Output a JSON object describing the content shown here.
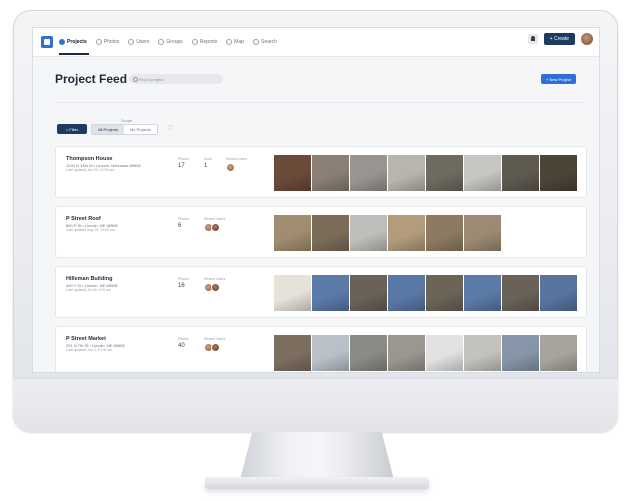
{
  "nav": {
    "items": [
      {
        "label": "Projects",
        "active": true
      },
      {
        "label": "Photos",
        "active": false
      },
      {
        "label": "Users",
        "active": false
      },
      {
        "label": "Groups",
        "active": false
      },
      {
        "label": "Reports",
        "active": false
      },
      {
        "label": "Map",
        "active": false
      },
      {
        "label": "Search",
        "active": false
      }
    ],
    "create_label": "+ Create"
  },
  "header": {
    "title": "Project Feed",
    "search_placeholder": "Find a project",
    "new_project_label": "+ New Project"
  },
  "filters": {
    "scope_label": "Scope",
    "filter_label": "= Filter",
    "all_projects_label": "All Projects",
    "my_projects_label": "My Projects"
  },
  "projects": [
    {
      "name": "Thompson House",
      "address": "1234 N 14th St • Lincoln, Nebraska 68508",
      "updated": "Last updated Jun 23, 10:00 am",
      "photos_label": "Photos",
      "photos": "17",
      "docs_label": "Docs",
      "docs": "1",
      "users_label": "Recent Users",
      "thumbs": [
        "#6b4a3a",
        "#8a7f74",
        "#9a9490",
        "#b8b4ae",
        "#6e6a60",
        "#c8c6c2",
        "#5f5a50",
        "#4d4438"
      ]
    },
    {
      "name": "P Street Roof",
      "address": "800 P St • Lincoln, NE 68508",
      "updated": "Last updated Aug 20, 10:00 am",
      "photos_label": "Photos",
      "photos": "6",
      "users_label": "Recent Users",
      "thumbs": [
        "#a08d70",
        "#7c6c5a",
        "#c0beba",
        "#b29c7c",
        "#8d7a62",
        "#9c8a74"
      ]
    },
    {
      "name": "Hillsman Building",
      "address": "400 Y St • Lincoln, NE 68508",
      "updated": "Last updated Jul 18, 9:00 am",
      "photos_label": "Photos",
      "photos": "16",
      "users_label": "Recent Users",
      "thumbs": [
        "#e6e2da",
        "#5a7aa8",
        "#6a6258",
        "#5a78a6",
        "#6d6458",
        "#5b7aa6",
        "#6a6258",
        "#57759f"
      ]
    },
    {
      "name": "P Street Market",
      "address": "201 N 7th St • Lincoln, NE 68508",
      "updated": "Last updated Jun 3, 10:00 am",
      "photos_label": "Photos",
      "photos": "40",
      "users_label": "Recent Users",
      "thumbs": [
        "#7d6f60",
        "#b9c0c8",
        "#8c8a86",
        "#9a9690",
        "#e2e2e0",
        "#c4c2be",
        "#8696a8",
        "#a7a49e"
      ]
    }
  ]
}
